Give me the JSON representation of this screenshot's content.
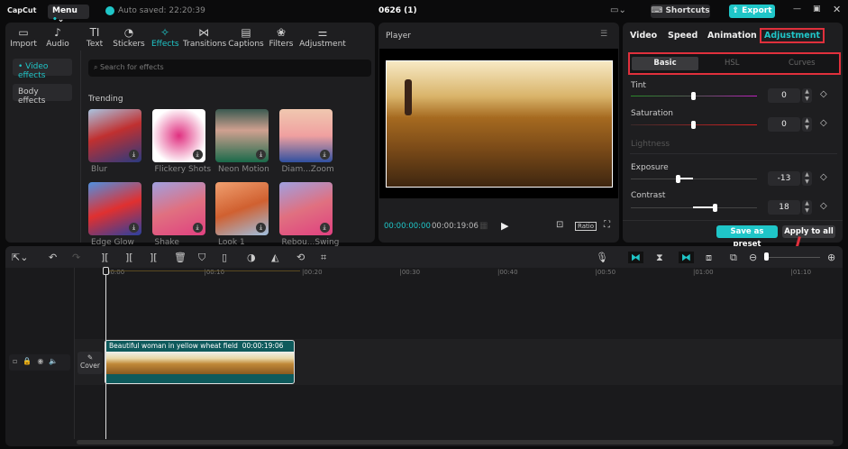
{
  "app": {
    "logo": "CapCut",
    "menu": "Menu",
    "autosave": "Auto saved: 22:20:39",
    "project_title": "0626 (1)",
    "shortcuts": "Shortcuts",
    "export": "Export"
  },
  "toolbar": [
    {
      "label": "Import",
      "icon": "▭"
    },
    {
      "label": "Audio",
      "icon": "♪"
    },
    {
      "label": "Text",
      "icon": "TI"
    },
    {
      "label": "Stickers",
      "icon": "◔"
    },
    {
      "label": "Effects",
      "icon": "✧"
    },
    {
      "label": "Transitions",
      "icon": "⋈"
    },
    {
      "label": "Captions",
      "icon": "▤"
    },
    {
      "label": "Filters",
      "icon": "❀"
    },
    {
      "label": "Adjustment",
      "icon": "⚌"
    }
  ],
  "effects": {
    "side": [
      "• Video effects",
      "Body effects"
    ],
    "search_placeholder": "Search for effects",
    "section": "Trending",
    "items": [
      "Blur",
      "Flickery Shots",
      "Neon Motion",
      "Diam...Zoom",
      "Edge Glow",
      "Shake",
      "Look 1",
      "Rebou...Swing"
    ]
  },
  "player": {
    "title": "Player",
    "current": "00:00:00:00",
    "total": "00:00:19:06",
    "ratio": "Ratio"
  },
  "inspector": {
    "tabs": [
      "Video",
      "Speed",
      "Animation",
      "Adjustment"
    ],
    "subtabs": [
      "Basic",
      "HSL",
      "Curves"
    ],
    "tint_label": "Tint",
    "tint": "0",
    "saturation_label": "Saturation",
    "saturation": "0",
    "lightness": "Lightness",
    "exposure_label": "Exposure",
    "exposure": "-13",
    "contrast_label": "Contrast",
    "contrast": "18",
    "save_preset": "Save as preset",
    "apply_all": "Apply to all"
  },
  "timeline": {
    "ruler": [
      "00:00",
      "|00:10",
      "|00:20",
      "|00:30",
      "|00:40",
      "|00:50",
      "|01:00",
      "|01:10"
    ],
    "clip_title": "Beautiful woman in yellow wheat field",
    "clip_duration": "00:00:19:06",
    "cover": "Cover"
  },
  "colors": {
    "accent": "#1fc6c8",
    "highlight": "#e0303c"
  }
}
